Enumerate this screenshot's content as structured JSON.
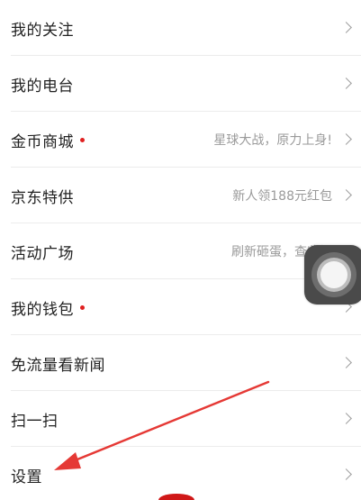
{
  "menu": {
    "items": [
      {
        "label": "我的关注",
        "sub": "",
        "dot": false
      },
      {
        "label": "我的电台",
        "sub": "",
        "dot": false
      },
      {
        "label": "金币商城",
        "sub": "星球大战，原力上身!",
        "dot": true
      },
      {
        "label": "京东特供",
        "sub": "新人领188元红包",
        "dot": false
      },
      {
        "label": "活动广场",
        "sub": "刷新砸蛋，查收好",
        "dot": false
      },
      {
        "label": "我的钱包",
        "sub": "",
        "dot": true
      },
      {
        "label": "免流量看新闻",
        "sub": "",
        "dot": false
      },
      {
        "label": "扫一扫",
        "sub": "",
        "dot": false
      },
      {
        "label": "设置",
        "sub": "",
        "dot": false
      }
    ]
  },
  "colors": {
    "text": "#222222",
    "subtext": "#9a9a9a",
    "badge_dot": "#e02020",
    "annotation_arrow": "#e53935",
    "assistive_touch_bg": "#4a4a4a"
  },
  "icons": {
    "chevron": "chevron-right-icon",
    "assistive": "assistive-touch-icon",
    "annotation": "red-arrow-annotation"
  }
}
